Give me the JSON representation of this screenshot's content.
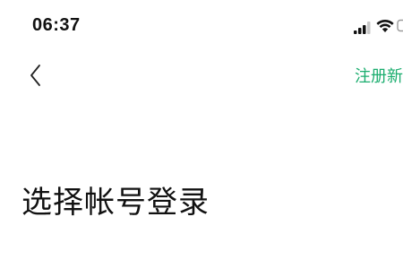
{
  "status_bar": {
    "time": "06:37",
    "icons": [
      "signal-icon",
      "wifi-icon",
      "battery-icon"
    ]
  },
  "nav_bar": {
    "back_icon": "chevron-left-icon",
    "register_label": "注册新"
  },
  "main": {
    "title": "选择帐号登录"
  },
  "colors": {
    "accent": "#1aad6e",
    "text": "#111111",
    "background": "#ffffff"
  }
}
